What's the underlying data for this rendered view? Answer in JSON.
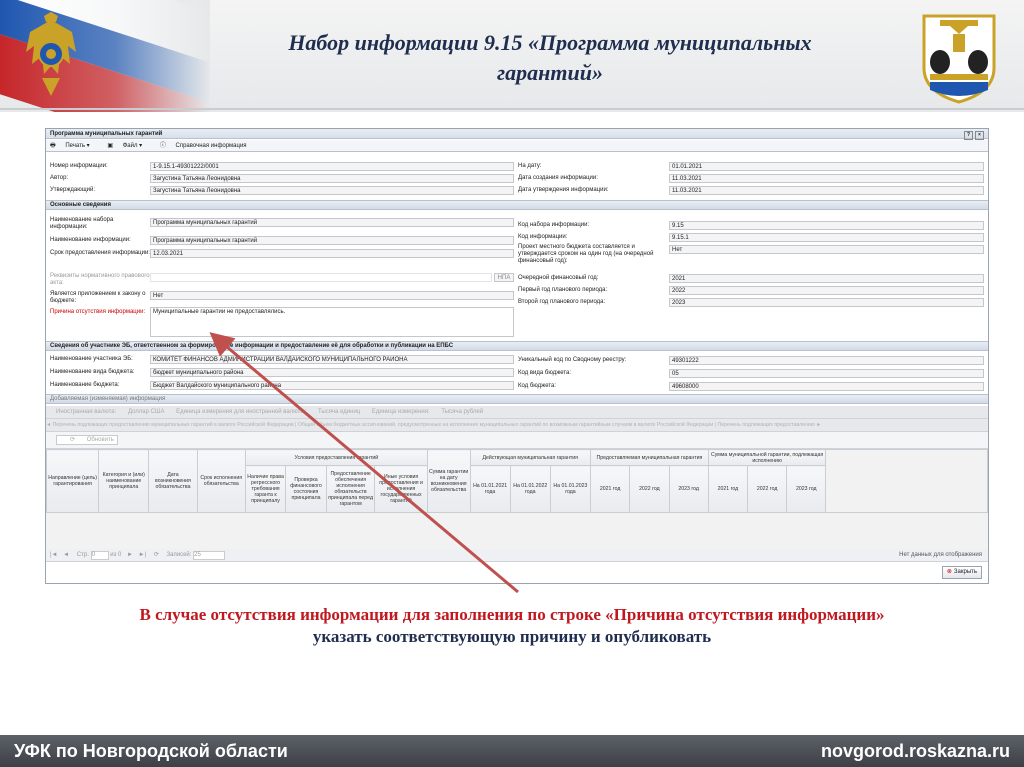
{
  "slide": {
    "title_line1": "Набор информации 9.15 «Программа муниципальных",
    "title_line2": "гарантий»",
    "caption_line1": "В случае отсутствия информации для заполнения по строке «Причина отсутствия информации»",
    "caption_line2": "указать соответствующую причину и опубликовать",
    "footer_left": "УФК по Новгородской области",
    "footer_right": "novgorod.roskazna.ru"
  },
  "app": {
    "window_title": "Программа муниципальных гарантий",
    "toolbar": {
      "print": "Печать ▾",
      "file": "Файл ▾",
      "help": "Справочная информация"
    },
    "header": {
      "number_label": "Номер информации:",
      "number_value": "1-9.15.1-49301222/0001",
      "author_label": "Автор:",
      "author_value": "Загустина Татьяна Леонидовна",
      "approver_label": "Утверждающий:",
      "approver_value": "Загустина Татьяна Леонидовна",
      "date_label": "На дату:",
      "date_value": "01.01.2021",
      "created_label": "Дата создания информации:",
      "created_value": "11.03.2021",
      "approved_label": "Дата утверждения информации:",
      "approved_value": "11.03.2021"
    },
    "main_section": "Основные сведения",
    "main": {
      "set_name_label": "Наименование набора информации:",
      "set_name_value": "Программа муниципальных гарантий",
      "info_name_label": "Наименование информации:",
      "info_name_value": "Программа муниципальных гарантий",
      "deadline_label": "Срок предоставления информации:",
      "deadline_value": "12.03.2021",
      "requisites_label": "Реквизиты нормативного правового акта:",
      "npa_button": "НПА",
      "appendix_label": "Является приложением к закону о бюджете:",
      "appendix_value": "Нет",
      "reason_label": "Причина отсутствия информации:",
      "reason_value": "Муниципальные гарантии не предоставлялись.",
      "set_code_label": "Код набора информации:",
      "set_code_value": "9.15",
      "info_code_label": "Код информации:",
      "info_code_value": "9.15.1",
      "project_label": "Проект местного бюджета составляется и утверждается сроком на один год (на очередной финансовый год):",
      "project_value": "Нет",
      "fy_label": "Очередной финансовый год:",
      "fy_value": "2021",
      "p1_label": "Первый год планового периода:",
      "p1_value": "2022",
      "p2_label": "Второй год планового периода:",
      "p2_value": "2023"
    },
    "participant_section": "Сведения об участнике ЭБ, ответственном за формирование информации и предоставление её для обработки и публикации на ЕПБС",
    "participant": {
      "name_label": "Наименование участника ЭБ:",
      "name_value": "КОМИТЕТ ФИНАНСОВ АДМИНИСТРАЦИИ ВАЛДАЙСКОГО МУНИЦИПАЛЬНОГО РАЙОНА",
      "budget_type_label": "Наименование вида бюджета:",
      "budget_type_value": "бюджет муниципального района",
      "budget_name_label": "Наименование бюджета:",
      "budget_name_value": "Бюджет Валдайского муниципального района",
      "reg_code_label": "Уникальный код по Сводному реестру:",
      "reg_code_value": "49301222",
      "budget_type_code_label": "Код вида бюджета:",
      "budget_type_code_value": "05",
      "budget_code_label": "Код бюджета:",
      "budget_code_value": "49608000"
    },
    "added_section": "Добавляемая (изменяемая) информация",
    "currency_row": {
      "currency": "Иностранная валюта:",
      "currency_value": "Доллар США",
      "unit_foreign": "Единица измерения для иностранной валюты:",
      "unit_foreign_value": "Тысяча единиц",
      "unit": "Единица измерения:",
      "unit_value": "Тысяча рублей"
    },
    "tabs_row": "◄  Перечень подлежащих предоставлению муниципальных гарантий в валюте Российской Федерации   |   Общий объем бюджетных ассигнований, предусмотренных на исполнение муниципальных гарантий по возможным гарантийным случаям в валюте Российской Федерации   |   Перечень подлежащих предоставлению ►",
    "refresh": "Обновить",
    "table": {
      "col_direction": "Направление (цель) гарантирования",
      "col_category": "Категория и (или) наименование принципала",
      "col_date": "Дата возникновения обязательства",
      "col_term": "Срок исполнения обязательства",
      "group_conditions": "Условия предоставления гарантий",
      "col_regress": "Наличие права регрессного требования гаранта к принципалу",
      "col_check": "Проверка финансового состояния принципала",
      "col_security": "Предоставление обеспечения исполнения обязательств принципала перед гарантом",
      "col_other": "Иные условия предоставления и исполнения государственных гарантий",
      "col_sum": "Сумма гарантии на дату возникновения обязательства",
      "group_current": "Действующая муниципальная гарантия",
      "cur1": "На 01.01.2021 года",
      "cur2": "На 01.01.2022 года",
      "cur3": "На 01.01.2023 года",
      "group_provided": "Предоставляемая муниципальная гарантия",
      "prov1": "2021 год",
      "prov2": "2022 год",
      "prov3": "2023 год",
      "group_exec": "Сумма муниципальной гарантии, подлежащая исполнению",
      "ex1": "2021 год",
      "ex2": "2022 год",
      "ex3": "2023 год"
    },
    "pager": {
      "page_label": "Стр.",
      "page_value": "0",
      "of_label": "из 0",
      "rows_label": "Записей:",
      "rows_value": "25",
      "no_data": "Нет данных для отображения"
    },
    "close_label": "Закрыть"
  }
}
